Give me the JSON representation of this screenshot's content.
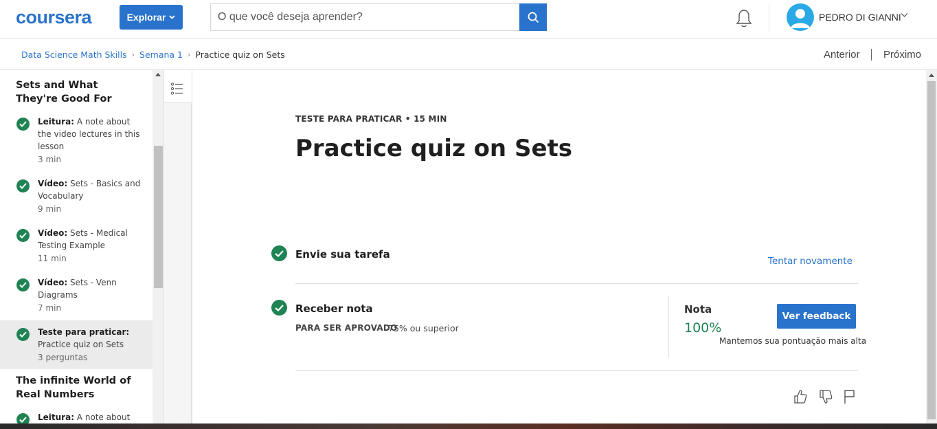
{
  "header": {
    "logo": "coursera",
    "explore_label": "Explorar",
    "search_placeholder": "O que você deseja aprender?",
    "user_name": "PEDRO DI GIANNI"
  },
  "breadcrumb": {
    "items": [
      "Data Science Math Skills",
      "Semana 1",
      "Practice quiz on Sets"
    ],
    "prev": "Anterior",
    "next": "Próximo"
  },
  "sidebar": {
    "sections": [
      {
        "title": "Sets and What They're Good For",
        "items": [
          {
            "type": "Leitura:",
            "name": "A note about the video lectures in this lesson",
            "duration": "3 min"
          },
          {
            "type": "Vídeo:",
            "name": "Sets - Basics and Vocabulary",
            "duration": "9 min"
          },
          {
            "type": "Vídeo:",
            "name": "Sets - Medical Testing Example",
            "duration": "11 min"
          },
          {
            "type": "Vídeo:",
            "name": "Sets - Venn Diagrams",
            "duration": "7 min"
          },
          {
            "type": "Teste para praticar:",
            "name": "Practice quiz on Sets",
            "duration": "3 perguntas"
          }
        ]
      },
      {
        "title": "The infinite World of Real Numbers",
        "items": [
          {
            "type": "Leitura:",
            "name": "A note about",
            "duration": ""
          }
        ]
      }
    ]
  },
  "main": {
    "kicker": "TESTE PARA PRATICAR • 15 MIN",
    "title": "Practice quiz on Sets",
    "submit_title": "Envie sua tarefa",
    "retry_label": "Tentar novamente",
    "grade_title": "Receber nota",
    "pass_label": "PARA SER APROVADO",
    "pass_value": "75% ou superior",
    "nota_label": "Nota",
    "nota_value": "100%",
    "feedback_label": "Ver feedback",
    "keep_note": "Mantemos sua pontuação mais alta"
  },
  "colors": {
    "brand": "#2a73cc",
    "success": "#1f8354"
  }
}
